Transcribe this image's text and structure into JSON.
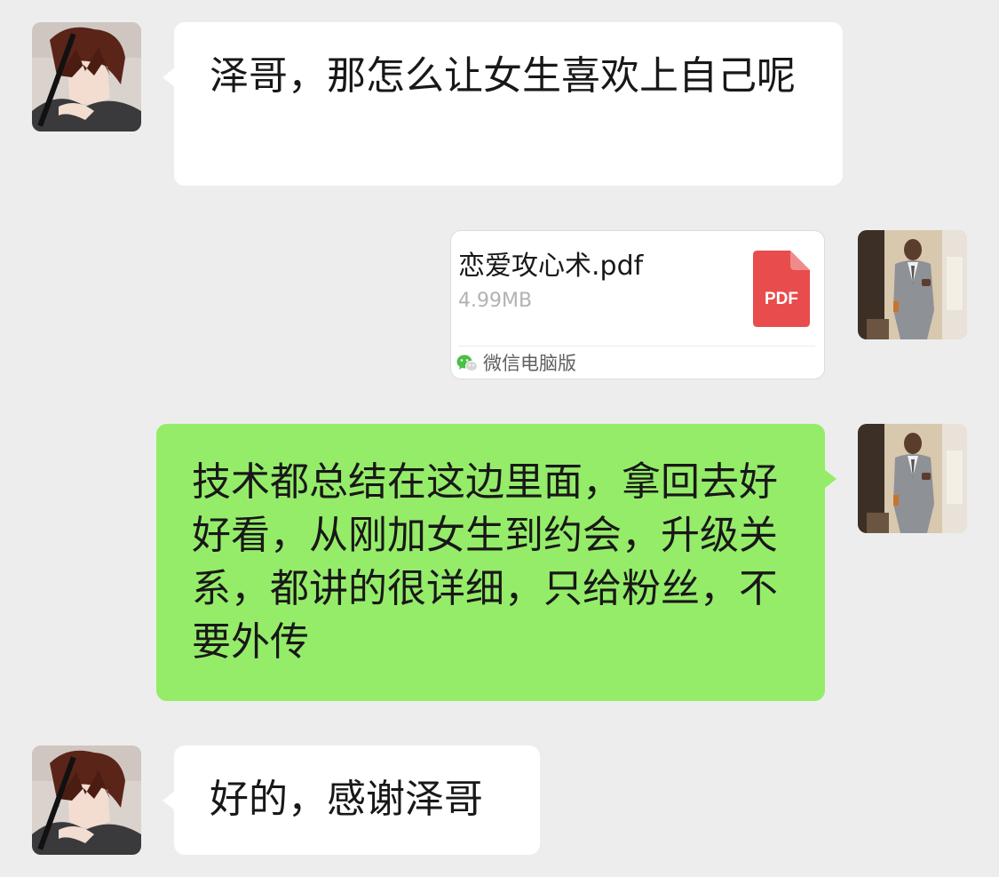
{
  "messages": [
    {
      "sender": "friend",
      "type": "text",
      "text": "泽哥，那怎么让女生喜欢上自己呢"
    },
    {
      "sender": "me",
      "type": "file",
      "file_name": "恋爱攻心术.pdf",
      "file_size": "4.99MB",
      "file_badge": "PDF",
      "source": "微信电脑版"
    },
    {
      "sender": "me",
      "type": "text",
      "text": "技术都总结在这边里面，拿回去好好看，从刚加女生到约会，升级关系，都讲的很详细，只给粉丝，不要外传"
    },
    {
      "sender": "friend",
      "type": "text",
      "text": "好的，感谢泽哥"
    }
  ],
  "colors": {
    "background": "#ededed",
    "received_bubble": "#ffffff",
    "sent_bubble": "#95ec69",
    "pdf_red": "#e84c4c"
  },
  "icons": {
    "friend_avatar": "anime-boy-avatar",
    "my_avatar": "man-in-suit-avatar",
    "file_type": "pdf-icon",
    "source": "wechat-icon"
  }
}
